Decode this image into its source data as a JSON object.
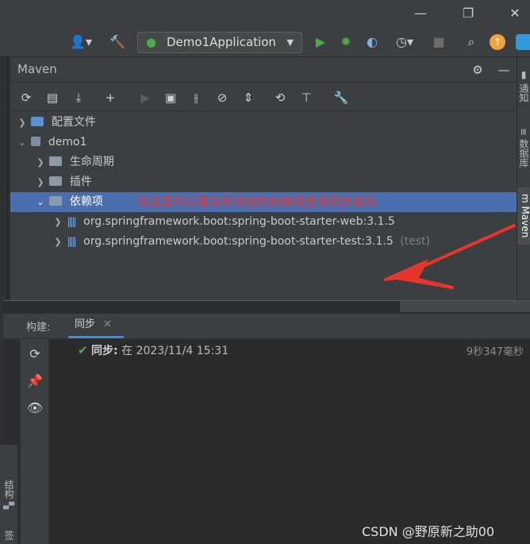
{
  "toolbar": {
    "run_config": "Demo1Application"
  },
  "maven": {
    "title": "Maven",
    "tree": [
      {
        "label": "配置文件",
        "level": 0
      },
      {
        "label": "demo1",
        "level": 0
      },
      {
        "label": "生命周期",
        "level": 1
      },
      {
        "label": "插件",
        "level": 1
      },
      {
        "label": "依赖项",
        "level": 1
      },
      {
        "label": "org.springframework.boot:spring-boot-starter-web:3.1.5",
        "level": 2
      },
      {
        "label": "org.springframework.boot:spring-boot-starter-test:3.1.5",
        "level": 2,
        "suffix": "(test)"
      }
    ],
    "annotation": "在这里可以看见所添加的依赖项是否同步成功"
  },
  "right_strip": {
    "tabs": [
      "通知",
      "数据库",
      "Maven"
    ]
  },
  "build": {
    "label": "构建:",
    "tab": "同步",
    "sync_prefix": "同步:",
    "sync_text": "在 2023/11/4 15:31",
    "sync_time": "9秒347毫秒"
  },
  "left_strip": {
    "structure_label": "结构",
    "bookmark_label": "签"
  },
  "watermark": "CSDN @野原新之助00",
  "colors": {
    "selection": "#4b6eaf",
    "annotation": "#e8352b",
    "run_green": "#4fa84a"
  }
}
